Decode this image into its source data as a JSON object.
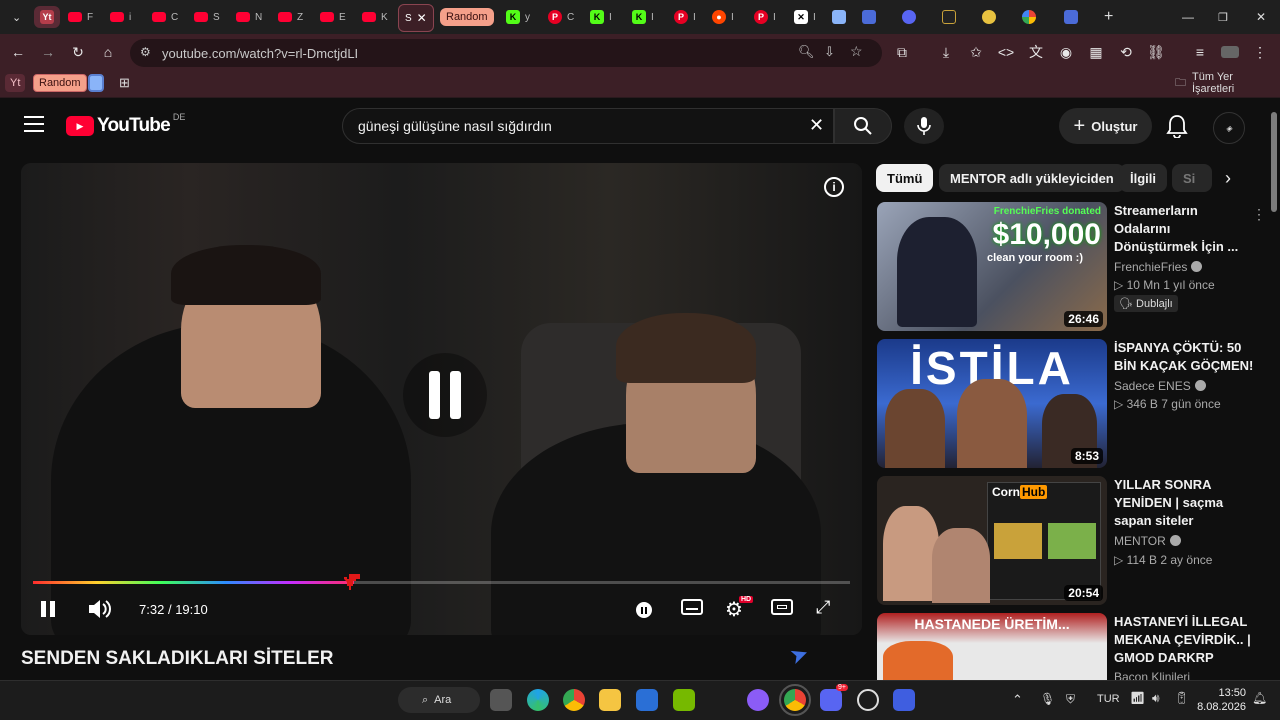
{
  "browser": {
    "tabs": [
      {
        "label": "Yt",
        "kind": "pinned"
      },
      {
        "label": "F",
        "kind": "youtube"
      },
      {
        "label": "i",
        "kind": "youtube"
      },
      {
        "label": "C",
        "kind": "youtube"
      },
      {
        "label": "S",
        "kind": "youtube"
      },
      {
        "label": "N",
        "kind": "youtube"
      },
      {
        "label": "Z",
        "kind": "youtube"
      },
      {
        "label": "E",
        "kind": "youtube"
      },
      {
        "label": "K",
        "kind": "youtube"
      },
      {
        "label": "S",
        "kind": "active"
      },
      {
        "label": "Random",
        "kind": "group"
      },
      {
        "label": "y",
        "kind": "kick"
      },
      {
        "label": "C",
        "kind": "pinterest"
      },
      {
        "label": "I",
        "kind": "kick"
      },
      {
        "label": "I",
        "kind": "kick"
      },
      {
        "label": "I",
        "kind": "pinterest"
      },
      {
        "label": "I",
        "kind": "reddit"
      },
      {
        "label": "I",
        "kind": "pinterest"
      },
      {
        "label": "I",
        "kind": "x"
      }
    ],
    "url": "youtube.com/watch?v=rl-DmctjdLI",
    "bookmarks": [
      {
        "label": "Yt"
      },
      {
        "label": "Random"
      }
    ],
    "all_bookmarks_label": "Tüm Yer İşaretleri"
  },
  "youtube": {
    "logo_text": "YouTube",
    "region": "DE",
    "search_query": "güneşi gülüşüne nasıl sığdırdın",
    "create_label": "Oluştur",
    "chips": [
      "Tümü",
      "MENTOR adlı yükleyiciden",
      "İlgili",
      "Si"
    ],
    "player": {
      "time_current": "7:32",
      "time_separator": "/",
      "time_total": "19:10",
      "progress": 0.393,
      "hd_badge": "HD"
    },
    "video_title": "SENDEN SAKLADIKLARI SİTELER",
    "suggestions": [
      {
        "title": "Streamerların Odalarını Dönüştürmek İçin ...",
        "channel": "FrenchieFries",
        "verified": true,
        "views": "10 Mn",
        "age": "1 yıl önce",
        "badge": "Dublajlı",
        "duration": "26:46",
        "thumb_text": [
          "FrenchieFries donated",
          "$10,000",
          "clean your room :)"
        ]
      },
      {
        "title": "İSPANYA ÇÖKTÜ: 50 BİN KAÇAK GÖÇMEN!",
        "channel": "Sadece ENES",
        "verified": true,
        "views": "346 B",
        "age": "7 gün önce",
        "duration": "8:53",
        "thumb_text": [
          "İSTİLA"
        ]
      },
      {
        "title": "YILLAR SONRA YENİDEN | saçma sapan siteler",
        "channel": "MENTOR",
        "verified": true,
        "views": "114 B",
        "age": "2 ay önce",
        "duration": "20:54",
        "thumb_text": [
          "Corn",
          "Hub"
        ]
      },
      {
        "title": "HASTANEYİ İLLEGAL MEKANA ÇEVİRDİK.. | GMOD DARKRP",
        "channel": "Bacon Klinileri",
        "verified": false,
        "thumb_text": [
          "HASTANEDE ÜRETİM..."
        ]
      }
    ]
  },
  "taskbar": {
    "search_label": "Ara",
    "language": "TUR",
    "time": "13:50",
    "date": "8.08.2026",
    "discord_badge": "9+"
  },
  "colors": {
    "accent": "#ff0033",
    "chrome_bg": "#3c1f26",
    "page_bg": "#0f0f0f"
  }
}
